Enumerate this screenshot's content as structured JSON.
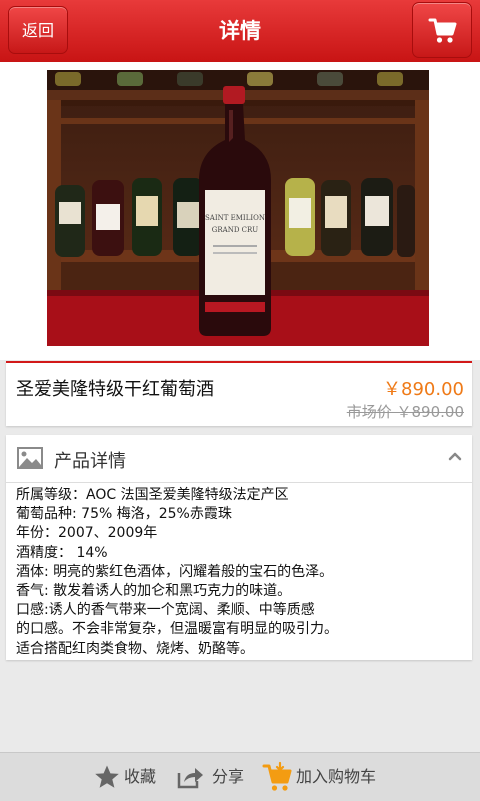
{
  "header": {
    "back_label": "返回",
    "title": "详情"
  },
  "gallery": {
    "bottle_label_line1": "SAINT EMILION",
    "bottle_label_line2": "GRAND CRU",
    "dot_count": 2,
    "active_dot": 1
  },
  "product": {
    "name": "圣爱美隆特级干红葡萄酒",
    "price": "￥890.00",
    "market_price": "市场价 ￥890.00"
  },
  "details": {
    "section_title": "产品详情",
    "lines": [
      "所属等级：AOC 法国圣爱美隆特级法定产区",
      "葡萄品种: 75% 梅洛，25%赤霞珠",
      "年份：2007、2009年",
      "酒精度： 14%",
      "酒体: 明亮的紫红色酒体，闪耀着般的宝石的色泽。",
      "香气: 散发着诱人的加仑和黑巧克力的味道。",
      "口感:诱人的香气带来一个宽阔、柔顺、中等质感",
      "的口感。不会非常复杂，但温暖富有明显的吸引力。",
      "适合搭配红肉类食物、烧烤、奶酪等。"
    ]
  },
  "bottom_bar": {
    "favorite_label": "收藏",
    "share_label": "分享",
    "add_cart_label": "加入购物车"
  },
  "colors": {
    "header_red": "#d21919",
    "price_orange": "#ef7a17",
    "cart_orange": "#f39c12"
  }
}
